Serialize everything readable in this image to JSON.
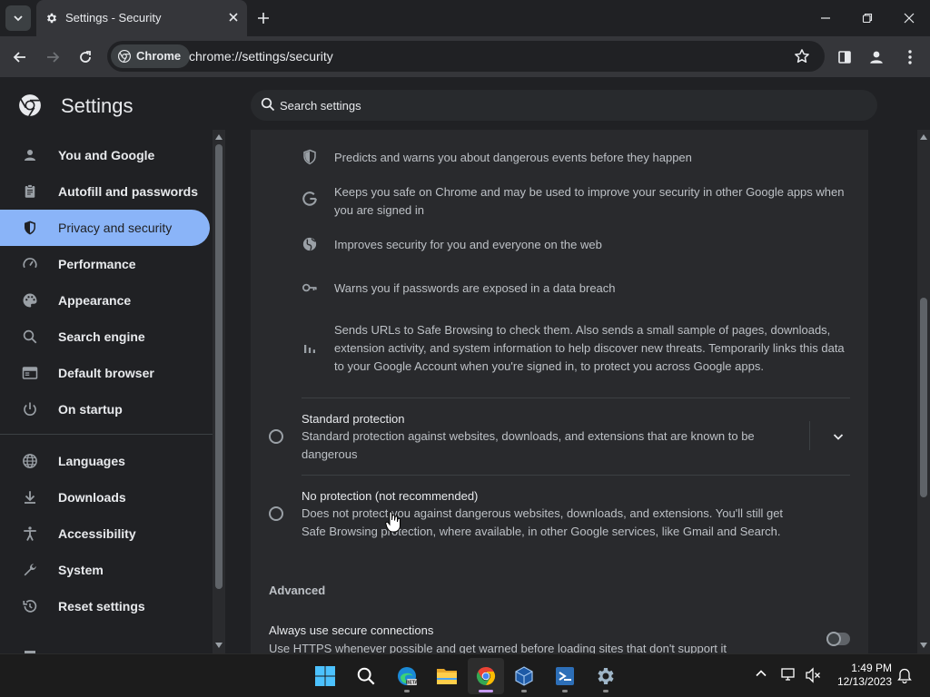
{
  "window": {
    "tab_title": "Settings - Security",
    "icons": {
      "tab_list": "chevron-down-icon",
      "favicon": "gear-icon",
      "close": "close-icon",
      "new_tab": "plus-icon",
      "minimize": "minimize-icon",
      "restore": "restore-icon",
      "window_close": "close-icon"
    }
  },
  "toolbar": {
    "chip_label": "Chrome",
    "url": "chrome://settings/security",
    "icons": [
      "back-icon",
      "forward-icon",
      "reload-icon",
      "star-icon",
      "side-panel-icon",
      "profile-icon",
      "more-icon"
    ]
  },
  "header": {
    "title": "Settings",
    "search_placeholder": "Search settings"
  },
  "sidebar": {
    "items": [
      {
        "label": "You and Google",
        "icon": "person-icon"
      },
      {
        "label": "Autofill and passwords",
        "icon": "clipboard-icon"
      },
      {
        "label": "Privacy and security",
        "icon": "shield-icon",
        "active": true
      },
      {
        "label": "Performance",
        "icon": "speedometer-icon"
      },
      {
        "label": "Appearance",
        "icon": "palette-icon"
      },
      {
        "label": "Search engine",
        "icon": "search-icon"
      },
      {
        "label": "Default browser",
        "icon": "browser-icon"
      },
      {
        "label": "On startup",
        "icon": "power-icon"
      },
      {
        "label": "Languages",
        "icon": "globe-icon"
      },
      {
        "label": "Downloads",
        "icon": "download-icon"
      },
      {
        "label": "Accessibility",
        "icon": "accessibility-icon"
      },
      {
        "label": "System",
        "icon": "wrench-icon"
      },
      {
        "label": "Reset settings",
        "icon": "history-icon"
      }
    ]
  },
  "main": {
    "features": [
      {
        "icon": "shield-icon",
        "text": "Predicts and warns you about dangerous events before they happen"
      },
      {
        "icon": "google-g-icon",
        "text": "Keeps you safe on Chrome and may be used to improve your security in other Google apps when you are signed in"
      },
      {
        "icon": "globe-icon",
        "text": "Improves security for you and everyone on the web"
      },
      {
        "icon": "key-icon",
        "text": "Warns you if passwords are exposed in a data breach"
      },
      {
        "icon": "bar-chart-icon",
        "text": "Sends URLs to Safe Browsing to check them. Also sends a small sample of pages, downloads, extension activity, and system information to help discover new threats. Temporarily links this data to your Google Account when you're signed in, to protect you across Google apps."
      }
    ],
    "standard": {
      "title": "Standard protection",
      "desc": "Standard protection against websites, downloads, and extensions that are known to be dangerous"
    },
    "no_protection": {
      "title": "No protection (not recommended)",
      "desc": "Does not protect you against dangerous websites, downloads, and extensions. You'll still get Safe Browsing protection, where available, in other Google services, like Gmail and Search."
    },
    "advanced_title": "Advanced",
    "secure_connections": {
      "title": "Always use secure connections",
      "desc": "Use HTTPS whenever possible and get warned before loading sites that don't support it",
      "enabled": false
    }
  },
  "taskbar": {
    "apps": [
      "windows-start-icon",
      "search-icon",
      "edge-beta-icon",
      "file-explorer-icon",
      "chrome-icon",
      "virtualbox-icon",
      "vscode-icon",
      "settings-gear-icon"
    ],
    "active_app": "chrome-icon",
    "time": "1:49 PM",
    "date": "12/13/2023"
  },
  "colors": {
    "accent": "#8ab4f8",
    "background": "#202124",
    "card": "#292a2d"
  }
}
